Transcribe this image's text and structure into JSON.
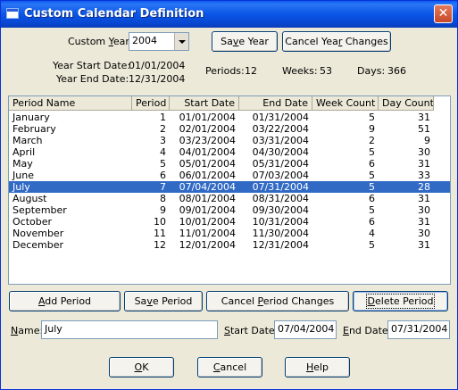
{
  "window": {
    "title": "Custom Calendar Definition",
    "close_glyph": "✕"
  },
  "year": {
    "label_pre": "Custom ",
    "label_u": "Y",
    "label_post": "ear:",
    "value": "2004",
    "save_pre": "Sa",
    "save_u": "v",
    "save_post": "e Year",
    "cancel_pre": "Cancel Yea",
    "cancel_u": "r",
    "cancel_post": " Changes"
  },
  "summary": {
    "start_label": "Year Start Date:",
    "start_value": "01/01/2004",
    "end_label": "Year End Date:",
    "end_value": "12/31/2004",
    "periods_label": "Periods:",
    "periods_value": "12",
    "weeks_label": "Weeks:",
    "weeks_value": "53",
    "days_label": "Days:",
    "days_value": "366"
  },
  "table": {
    "columns": [
      "Period Name",
      "Period",
      "Start Date",
      "End Date",
      "Week Count",
      "Day Count"
    ],
    "rows": [
      [
        "January",
        "1",
        "01/01/2004",
        "01/31/2004",
        "5",
        "31"
      ],
      [
        "February",
        "2",
        "02/01/2004",
        "03/22/2004",
        "9",
        "51"
      ],
      [
        "March",
        "3",
        "03/23/2004",
        "03/31/2004",
        "2",
        "9"
      ],
      [
        "April",
        "4",
        "04/01/2004",
        "04/30/2004",
        "5",
        "30"
      ],
      [
        "May",
        "5",
        "05/01/2004",
        "05/31/2004",
        "6",
        "31"
      ],
      [
        "June",
        "6",
        "06/01/2004",
        "07/03/2004",
        "5",
        "33"
      ],
      [
        "July",
        "7",
        "07/04/2004",
        "07/31/2004",
        "5",
        "28"
      ],
      [
        "August",
        "8",
        "08/01/2004",
        "08/31/2004",
        "6",
        "31"
      ],
      [
        "September",
        "9",
        "09/01/2004",
        "09/30/2004",
        "5",
        "30"
      ],
      [
        "October",
        "10",
        "10/01/2004",
        "10/31/2004",
        "6",
        "31"
      ],
      [
        "November",
        "11",
        "11/01/2004",
        "11/30/2004",
        "4",
        "30"
      ],
      [
        "December",
        "12",
        "12/01/2004",
        "12/31/2004",
        "5",
        "31"
      ]
    ],
    "selected_index": 6
  },
  "period_buttons": {
    "add_u": "A",
    "add_post": "dd Period",
    "save_pre": "Sa",
    "save_u": "v",
    "save_post": "e Period",
    "cancel_pre": "Cancel ",
    "cancel_u": "P",
    "cancel_post": "eriod Changes",
    "delete_u": "D",
    "delete_post": "elete Period"
  },
  "edit": {
    "name_u": "N",
    "name_post": "ame:",
    "name_value": "July",
    "start_u": "S",
    "start_post": "tart Date:",
    "start_value": "07/04/2004",
    "end_u": "E",
    "end_post": "nd Date:",
    "end_value": "07/31/2004"
  },
  "dialog_buttons": {
    "ok_u": "O",
    "ok_post": "K",
    "cancel_u": "C",
    "cancel_post": "ancel",
    "help_u": "H",
    "help_post": "elp"
  }
}
